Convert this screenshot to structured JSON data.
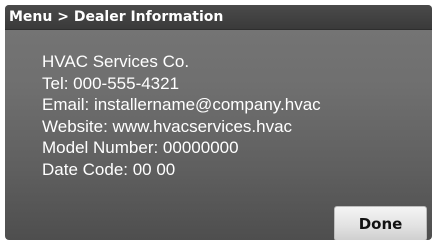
{
  "header": {
    "breadcrumb": "Menu > Dealer Information"
  },
  "dealer_info": {
    "lines": [
      "HVAC Services Co.",
      "Tel: 000-555-4321",
      "Email: installername@company.hvac",
      "Website: www.hvacservices.hvac",
      "Model Number: 00000000",
      "Date Code: 00 00"
    ]
  },
  "footer": {
    "done_label": "Done"
  },
  "colors": {
    "panel_background": "#6b6b6b",
    "titlebar_background": "#404040",
    "text": "#ffffff",
    "button_background": "#e6e6e6"
  }
}
